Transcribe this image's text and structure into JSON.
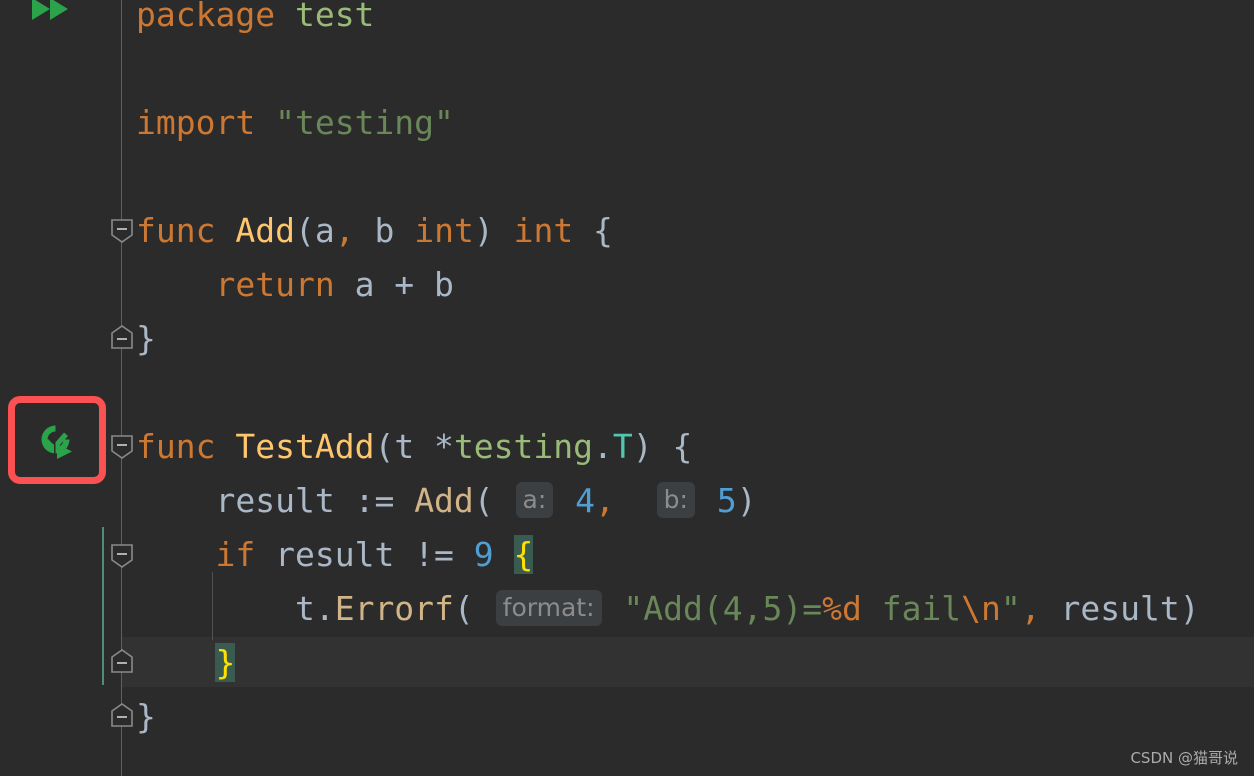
{
  "editor": {
    "language": "Go",
    "theme": "Darcula",
    "background_color": "#2b2b2b",
    "current_line_color": "#323232",
    "gutter_color": "#2b2b2b",
    "accent_run_color": "#2aa34a",
    "annotation_box_color": "#fa5252",
    "scope_bar_color": "#4e8c7e",
    "brace_match_bg": "#3a5c50",
    "brace_match_fg": "#ffe000"
  },
  "gutter": {
    "run_all_icon": "double-chevron-run-icon",
    "run_test_icon": "run-test-success-icon",
    "fold_markers": [
      {
        "name": "fold-open-marker",
        "line": "func Add",
        "direction": "open"
      },
      {
        "name": "fold-close-marker",
        "line": "} end of Add",
        "direction": "close"
      },
      {
        "name": "fold-open-marker",
        "line": "func TestAdd",
        "direction": "open"
      },
      {
        "name": "fold-open-marker",
        "line": "if result != 9 {",
        "direction": "open"
      },
      {
        "name": "fold-close-marker",
        "line": "} end of if",
        "direction": "close"
      },
      {
        "name": "fold-close-marker",
        "line": "} end of TestAdd",
        "direction": "close"
      }
    ]
  },
  "code": {
    "lines": [
      {
        "id": "line-package",
        "tokens": [
          {
            "t": "package",
            "c": "tok-keyword"
          },
          {
            "t": " ",
            "c": "tok-punc"
          },
          {
            "t": "test",
            "c": "tok-pkg"
          }
        ]
      },
      {
        "id": "line-import",
        "tokens": [
          {
            "t": "import",
            "c": "tok-keyword"
          },
          {
            "t": " ",
            "c": "tok-punc"
          },
          {
            "t": "\"testing\"",
            "c": "tok-string"
          }
        ]
      },
      {
        "id": "line-func-add",
        "tokens": [
          {
            "t": "func",
            "c": "tok-keyword"
          },
          {
            "t": " ",
            "c": "tok-punc"
          },
          {
            "t": "Add",
            "c": "tok-func"
          },
          {
            "t": "(",
            "c": "tok-punc"
          },
          {
            "t": "a",
            "c": "tok-ident"
          },
          {
            "t": ",",
            "c": "tok-keyword"
          },
          {
            "t": " ",
            "c": "tok-punc"
          },
          {
            "t": "b",
            "c": "tok-ident"
          },
          {
            "t": " ",
            "c": "tok-punc"
          },
          {
            "t": "int",
            "c": "tok-keyword"
          },
          {
            "t": ")",
            "c": "tok-punc"
          },
          {
            "t": " ",
            "c": "tok-punc"
          },
          {
            "t": "int",
            "c": "tok-keyword"
          },
          {
            "t": " {",
            "c": "tok-punc"
          }
        ]
      },
      {
        "id": "line-return",
        "tokens": [
          {
            "t": "    ",
            "c": "tok-punc"
          },
          {
            "t": "return",
            "c": "tok-keyword"
          },
          {
            "t": " a + b",
            "c": "tok-ident"
          }
        ]
      },
      {
        "id": "line-close-add",
        "tokens": [
          {
            "t": "}",
            "c": "tok-punc"
          }
        ]
      },
      {
        "id": "line-func-testadd",
        "tokens": [
          {
            "t": "func",
            "c": "tok-keyword"
          },
          {
            "t": " ",
            "c": "tok-punc"
          },
          {
            "t": "TestAdd",
            "c": "tok-func"
          },
          {
            "t": "(",
            "c": "tok-punc"
          },
          {
            "t": "t",
            "c": "tok-ident"
          },
          {
            "t": " *",
            "c": "tok-punc"
          },
          {
            "t": "testing",
            "c": "tok-pkg"
          },
          {
            "t": ".",
            "c": "tok-punc"
          },
          {
            "t": "T",
            "c": "tok-type"
          },
          {
            "t": ") {",
            "c": "tok-punc"
          }
        ]
      },
      {
        "id": "line-result-assign",
        "tokens": [
          {
            "t": "    ",
            "c": "tok-punc"
          },
          {
            "t": "result",
            "c": "tok-ident"
          },
          {
            "t": " := ",
            "c": "tok-punc"
          },
          {
            "t": "Add",
            "c": "tok-method"
          },
          {
            "t": "( ",
            "c": "tok-punc"
          },
          {
            "t": "a:",
            "c": "hint-chip"
          },
          {
            "t": " ",
            "c": "tok-punc"
          },
          {
            "t": "4",
            "c": "tok-number"
          },
          {
            "t": ",",
            "c": "tok-keyword"
          },
          {
            "t": "  ",
            "c": "tok-punc"
          },
          {
            "t": "b:",
            "c": "hint-chip"
          },
          {
            "t": " ",
            "c": "tok-punc"
          },
          {
            "t": "5",
            "c": "tok-number"
          },
          {
            "t": ")",
            "c": "tok-punc"
          }
        ]
      },
      {
        "id": "line-if",
        "tokens": [
          {
            "t": "    ",
            "c": "tok-punc"
          },
          {
            "t": "if",
            "c": "tok-keyword"
          },
          {
            "t": " result != ",
            "c": "tok-ident"
          },
          {
            "t": "9",
            "c": "tok-number"
          },
          {
            "t": " ",
            "c": "tok-punc"
          },
          {
            "t": "{",
            "c": "tok-brace-match"
          }
        ]
      },
      {
        "id": "line-errorf",
        "tokens": [
          {
            "t": "        ",
            "c": "tok-punc"
          },
          {
            "t": "t",
            "c": "tok-ident"
          },
          {
            "t": ".",
            "c": "tok-punc"
          },
          {
            "t": "Errorf",
            "c": "tok-method"
          },
          {
            "t": "( ",
            "c": "tok-punc"
          },
          {
            "t": "format:",
            "c": "hint-chip"
          },
          {
            "t": " ",
            "c": "tok-punc"
          },
          {
            "t": "\"Add(4,5)=",
            "c": "tok-string"
          },
          {
            "t": "%d",
            "c": "tok-escape"
          },
          {
            "t": " fail",
            "c": "tok-string"
          },
          {
            "t": "\\n",
            "c": "tok-escape"
          },
          {
            "t": "\"",
            "c": "tok-string"
          },
          {
            "t": ",",
            "c": "tok-keyword"
          },
          {
            "t": " result",
            "c": "tok-ident"
          },
          {
            "t": ")",
            "c": "tok-punc"
          }
        ]
      },
      {
        "id": "line-close-if",
        "tokens": [
          {
            "t": "    ",
            "c": "tok-punc"
          },
          {
            "t": "}",
            "c": "tok-brace-match"
          }
        ]
      },
      {
        "id": "line-close-testadd",
        "tokens": [
          {
            "t": "}",
            "c": "tok-punc"
          }
        ]
      }
    ]
  },
  "watermark": {
    "text": "CSDN @猫哥说"
  }
}
